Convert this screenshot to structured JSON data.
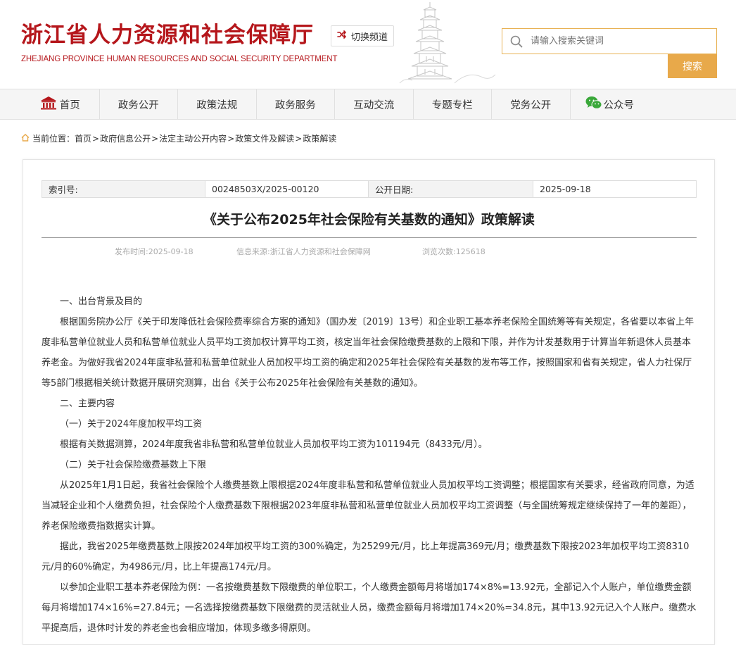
{
  "header": {
    "site_title_cn": "浙江省人力资源和社会保障厅",
    "site_title_en": "ZHEJIANG PROVINCE HUMAN RESOURCES AND SOCIAL SECURITY DEPARTMENT",
    "switch_channel_label": "切换频道",
    "switch_icon": "shuffle-icon",
    "search_placeholder": "请输入搜索关键词",
    "search_button_label": "搜索",
    "brand_color": "#b5161b",
    "accent_color": "#e8a94a"
  },
  "nav": {
    "items": [
      {
        "label": "首页",
        "icon": "home-building-icon"
      },
      {
        "label": "政务公开"
      },
      {
        "label": "政策法规"
      },
      {
        "label": "政务服务"
      },
      {
        "label": "互动交流"
      },
      {
        "label": "专题专栏"
      },
      {
        "label": "党务公开"
      },
      {
        "label": "公众号",
        "icon": "wechat-icon"
      }
    ]
  },
  "breadcrumb": {
    "prefix": "当前位置：",
    "items": [
      "首页",
      "政府信息公开",
      "法定主动公开内容",
      "政策文件及解读",
      "政策解读"
    ],
    "separator": ">"
  },
  "article": {
    "meta": {
      "index_label": "索引号:",
      "index_value": "00248503X/2025-00120",
      "date_label": "公开日期:",
      "date_value": "2025-09-18"
    },
    "title": "《关于公布2025年社会保险有关基数的通知》政策解读",
    "publish_time": "发布时间:2025-09-18",
    "source": "信息来源:浙江省人力资源和社会保障网",
    "views": "浏览次数:125618",
    "paragraphs": [
      "一、出台背景及目的",
      "根据国务院办公厅《关于印发降低社会保险费率综合方案的通知》（国办发〔2019〕13号）和企业职工基本养老保险全国统筹等有关规定，各省要以本省上年度非私营单位就业人员和私营单位就业人员平均工资加权计算平均工资，核定当年社会保险缴费基数的上限和下限，并作为计发基数用于计算当年新退休人员基本养老金。为做好我省2024年度非私营和私营单位就业人员加权平均工资的确定和2025年社会保险有关基数的发布等工作，按照国家和省有关规定，省人力社保厅等5部门根据相关统计数据开展研究测算，出台《关于公布2025年社会保险有关基数的通知》。",
      "二、主要内容",
      "（一）关于2024年度加权平均工资",
      "根据有关数据测算，2024年度我省非私营和私营单位就业人员加权平均工资为101194元（8433元/月）。",
      "（二）关于社会保险缴费基数上下限",
      "从2025年1月1日起，我省社会保险个人缴费基数上限根据2024年度非私营和私营单位就业人员加权平均工资调整；根据国家有关要求，经省政府同意，为适当减轻企业和个人缴费负担，社会保险个人缴费基数下限根据2023年度非私营和私营单位就业人员加权平均工资调整（与全国统筹规定继续保持了一年的差距），养老保险缴费指数据实计算。",
      "据此，我省2025年缴费基数上限按2024年加权平均工资的300%确定，为25299元/月，比上年提高369元/月；缴费基数下限按2023年加权平均工资8310元/月的60%确定，为4986元/月，比上年提高174元/月。",
      "以参加企业职工基本养老保险为例：一名按缴费基数下限缴费的单位职工，个人缴费金额每月将增加174×8%=13.92元，全部记入个人账户，单位缴费金额每月将增加174×16%=27.84元；一名选择按缴费基数下限缴费的灵活就业人员，缴费金额每月将增加174×20%=34.8元，其中13.92元记入个人账户。缴费水平提高后，退休时计发的养老金也会相应增加，体现多缴多得原则。"
    ]
  }
}
